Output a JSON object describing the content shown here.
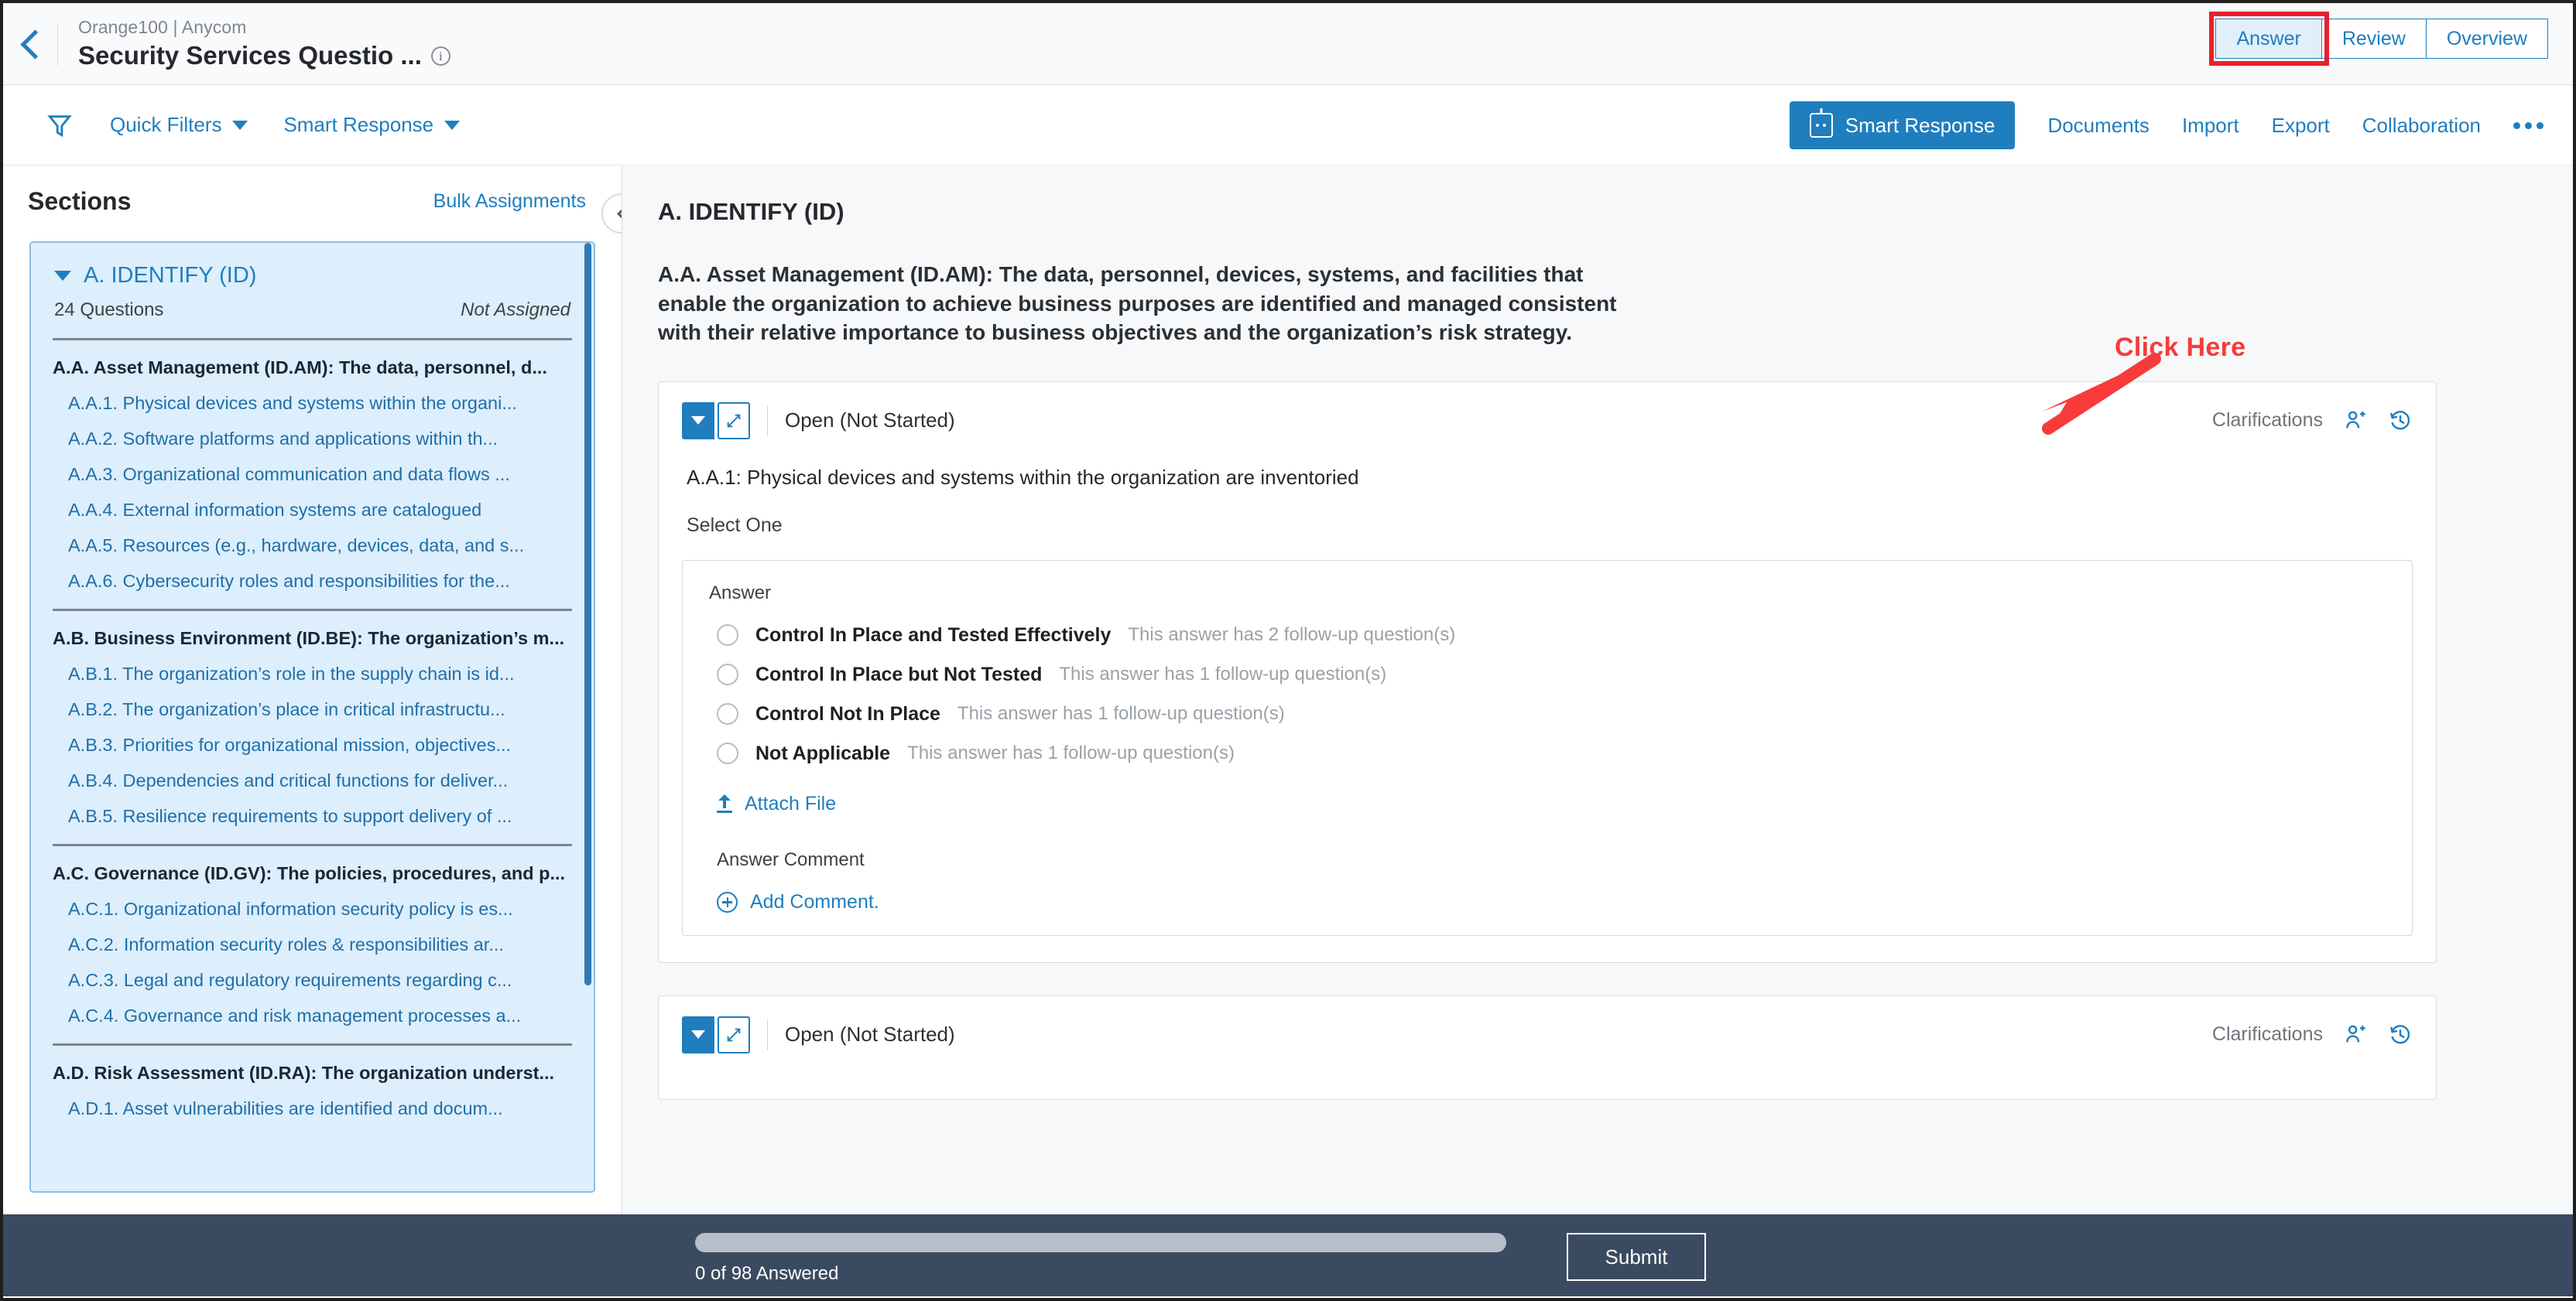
{
  "header": {
    "breadcrumb": "Orange100 | Anycom",
    "title": "Security Services Questio ...",
    "back_icon": "chevron-left-icon",
    "info_icon": "info-icon",
    "tabs": [
      {
        "label": "Answer",
        "active": true
      },
      {
        "label": "Review",
        "active": false
      },
      {
        "label": "Overview",
        "active": false
      }
    ]
  },
  "toolbar": {
    "filter_icon": "funnel-icon",
    "quick_filters": "Quick Filters",
    "smart_response_menu": "Smart Response",
    "smart_response_button": "Smart Response",
    "documents": "Documents",
    "import": "Import",
    "export": "Export",
    "collaboration": "Collaboration",
    "overflow": "more-options-icon"
  },
  "sidebar": {
    "title": "Sections",
    "bulk_assignments": "Bulk Assignments",
    "collapse_icon": "chevron-left-icon",
    "section": {
      "name": "A. IDENTIFY (ID)",
      "question_count": "24 Questions",
      "assignment": "Not Assigned"
    },
    "groups": [
      {
        "label": "A.A. Asset Management (ID.AM): The data, personnel, d...",
        "items": [
          "A.A.1. Physical devices and systems within the organi...",
          "A.A.2. Software platforms and applications within th...",
          "A.A.3. Organizational communication and data flows ...",
          "A.A.4. External information systems are catalogued",
          "A.A.5. Resources (e.g., hardware, devices, data, and s...",
          "A.A.6. Cybersecurity roles and responsibilities for the..."
        ]
      },
      {
        "label": "A.B. Business Environment (ID.BE): The organization’s m...",
        "items": [
          "A.B.1. The organization’s role in the supply chain is id...",
          "A.B.2. The organization’s place in critical infrastructu...",
          "A.B.3. Priorities for organizational mission, objectives...",
          "A.B.4. Dependencies and critical functions for deliver...",
          "A.B.5. Resilience requirements to support delivery of ..."
        ]
      },
      {
        "label": "A.C. Governance (ID.GV): The policies, procedures, and p...",
        "items": [
          "A.C.1. Organizational information security policy is es...",
          "A.C.2. Information security roles & responsibilities ar...",
          "A.C.3. Legal and regulatory requirements regarding c...",
          "A.C.4. Governance and risk management processes a..."
        ]
      },
      {
        "label": "A.D. Risk Assessment (ID.RA): The organization underst...",
        "items": [
          "A.D.1. Asset vulnerabilities are identified and docum..."
        ]
      }
    ]
  },
  "main": {
    "section_title": "A. IDENTIFY (ID)",
    "section_description": "A.A. Asset Management (ID.AM): The data, personnel, devices, systems, and facilities that enable the organization to achieve business purposes are identified and managed consistent with their relative importance to business objectives and the organization’s risk strategy.",
    "cards": [
      {
        "collapse_icon": "chevron-down-icon",
        "expand_icon": "expand-icon",
        "status": "Open (Not Started)",
        "clarifications": "Clarifications",
        "assign_icon": "add-person-icon",
        "history_icon": "history-clock-icon",
        "question": "A.A.1: Physical devices and systems within the organization are inventoried",
        "select_one": "Select One",
        "answer_label": "Answer",
        "options": [
          {
            "label": "Control In Place and Tested Effectively",
            "note": "This answer has 2 follow-up question(s)",
            "selected": false
          },
          {
            "label": "Control In Place but Not Tested",
            "note": "This answer has 1 follow-up question(s)",
            "selected": false
          },
          {
            "label": "Control Not In Place",
            "note": "This answer has 1 follow-up question(s)",
            "selected": false
          },
          {
            "label": "Not Applicable",
            "note": "This answer has 1 follow-up question(s)",
            "selected": false
          }
        ],
        "attach_file": "Attach File",
        "answer_comment_label": "Answer Comment",
        "add_comment": "Add Comment."
      },
      {
        "collapse_icon": "chevron-down-icon",
        "expand_icon": "expand-icon",
        "status": "Open (Not Started)",
        "clarifications": "Clarifications",
        "assign_icon": "add-person-icon",
        "history_icon": "history-clock-icon"
      }
    ]
  },
  "annotation": {
    "text": "Click Here",
    "color": "#f83a3a",
    "highlight_target": "Answer"
  },
  "footer": {
    "progress_text": "0 of 98 Answered",
    "progress_percent": 0,
    "submit": "Submit"
  },
  "colors": {
    "accent_blue": "#1f7ebe",
    "annotation_red": "#f83a3a",
    "footer_bg": "#3a4a60",
    "sidebar_selected_bg": "#ddeefc"
  }
}
